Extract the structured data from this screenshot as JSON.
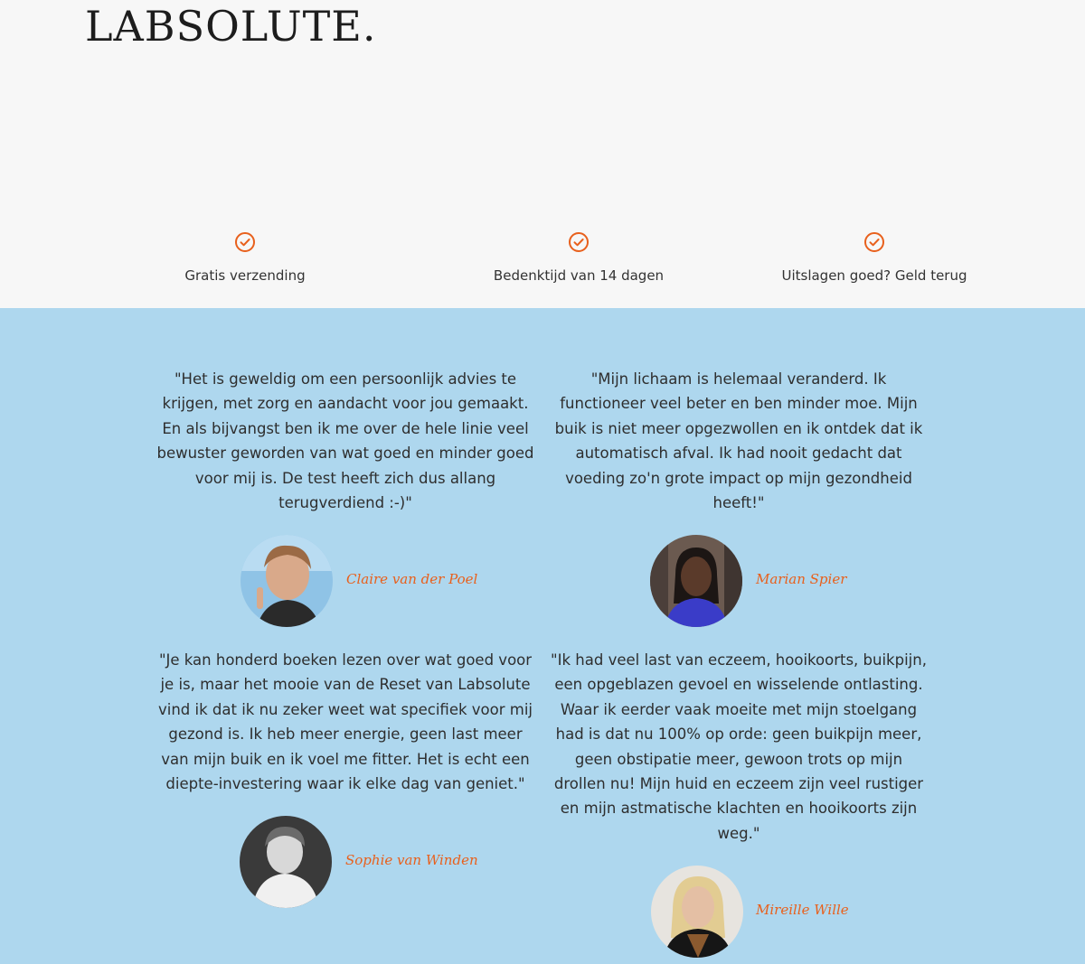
{
  "brand": {
    "logo_text": "LABSOLUTE."
  },
  "usps": [
    {
      "icon": "check-circle-icon",
      "label": "Gratis verzending"
    },
    {
      "icon": "check-circle-icon",
      "label": "Bedenktijd van 14 dagen"
    },
    {
      "icon": "check-circle-icon",
      "label": "Uitslagen goed? Geld terug"
    }
  ],
  "colors": {
    "accent": "#e8601c",
    "reviews_bg": "#aed7ee",
    "top_bg": "#f7f7f7"
  },
  "reviews": [
    {
      "quote": "\"Het is geweldig om een persoonlijk advies te krijgen, met zorg en aandacht voor jou gemaakt. En als bijvangst ben ik me over de hele linie veel bewuster geworden van wat goed en minder goed voor mij is. De test heeft zich dus allang terugverdiend :-)\"",
      "name": "Claire van der Poel"
    },
    {
      "quote": "\"Mijn lichaam is helemaal veranderd. Ik functioneer veel beter en ben minder moe. Mijn buik is niet meer opgezwollen en ik ontdek dat ik automatisch afval. Ik had nooit gedacht dat voeding zo'n grote impact op mijn gezondheid heeft!\"",
      "name": "Marian Spier"
    },
    {
      "quote": "\"Je kan honderd boeken lezen over wat goed voor je is, maar het mooie van de Reset van Labsolute vind ik dat ik nu zeker weet wat specifiek voor mij gezond is. Ik heb meer energie, geen last meer van mijn buik en ik voel me fitter. Het is echt een diepte-investering waar ik elke dag van geniet.\"",
      "name": "Sophie van Winden"
    },
    {
      "quote": "\"Ik had veel last van eczeem, hooikoorts, buikpijn, een opgeblazen gevoel en wisselende ontlasting. Waar ik eerder vaak moeite met mijn stoelgang had is dat nu 100% op orde: geen buikpijn meer, geen obstipatie meer, gewoon trots op mijn drollen nu! Mijn huid en eczeem zijn veel rustiger en mijn astmatische klachten en hooikoorts zijn weg.\"",
      "name": "Mireille Wille"
    }
  ]
}
